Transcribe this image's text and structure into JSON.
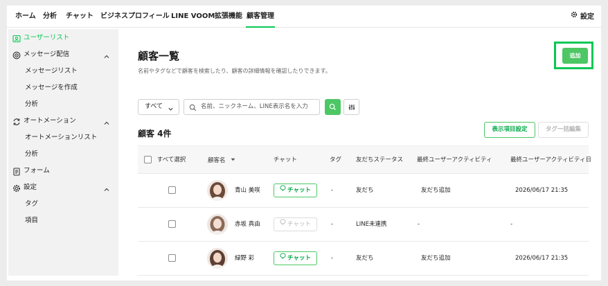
{
  "nav": {
    "tabs": [
      {
        "label": "ホーム"
      },
      {
        "label": "分析"
      },
      {
        "label": "チャット"
      },
      {
        "label": "ビジネスプロフィール"
      },
      {
        "label": "LINE VOOM"
      },
      {
        "label": "拡張機能"
      },
      {
        "label": "顧客管理"
      }
    ],
    "active_tab": "顧客管理",
    "settings_label": "設定"
  },
  "sidebar": {
    "items": [
      {
        "label": "ユーザーリスト",
        "icon": "user-list-icon",
        "active": true
      },
      {
        "label": "メッセージ配信",
        "icon": "broadcast-icon",
        "expanded": true
      },
      {
        "label": "メッセージリスト",
        "sub": true
      },
      {
        "label": "メッセージを作成",
        "sub": true
      },
      {
        "label": "分析",
        "sub": true
      },
      {
        "label": "オートメーション",
        "icon": "automation-icon",
        "expanded": true
      },
      {
        "label": "オートメーションリスト",
        "sub": true
      },
      {
        "label": "分析",
        "sub": true
      },
      {
        "label": "フォーム",
        "icon": "form-icon"
      },
      {
        "label": "設定",
        "icon": "gear-icon",
        "expanded": true
      },
      {
        "label": "タグ",
        "sub": true
      },
      {
        "label": "項目",
        "sub": true
      }
    ]
  },
  "main": {
    "title": "顧客一覧",
    "subtitle": "名前やタグなどで顧客を検索したり、顧客の詳細情報を確認したりできます。",
    "add_label": "追加",
    "filter_value": "すべて",
    "search_placeholder": "名前、ニックネーム、LINE表示名を入力",
    "count_label": "顧客 4件",
    "column_settings_label": "表示項目設定",
    "bulk_tag_label": "タグ一括編集"
  },
  "table": {
    "headers": {
      "select_all": "すべて選択",
      "name": "顧客名",
      "chat": "チャット",
      "tag": "タグ",
      "friend_status": "友だちステータス",
      "last_activity": "最終ユーザーアクティビティ",
      "last_activity_date": "最終ユーザーアクティビティ日"
    },
    "rows": [
      {
        "name": "青山 美咲",
        "chat": "チャット",
        "chat_enabled": true,
        "tag": "-",
        "friend_status": "友だち",
        "last_activity": "友だち追加",
        "last_activity_date": "2026/06/17 21:35"
      },
      {
        "name": "赤坂 真由",
        "chat": "チャット",
        "chat_enabled": false,
        "tag": "-",
        "friend_status": "LINE未連携",
        "last_activity": "-",
        "last_activity_date": "-"
      },
      {
        "name": "緑野 彩",
        "chat": "チャット",
        "chat_enabled": true,
        "tag": "-",
        "friend_status": "友だち",
        "last_activity": "友だち追加",
        "last_activity_date": "2026/06/17 21:35"
      }
    ]
  },
  "colors": {
    "accent": "#06c755",
    "button_green": "#4cc764",
    "sidebar_bg": "#f2f2f2"
  }
}
